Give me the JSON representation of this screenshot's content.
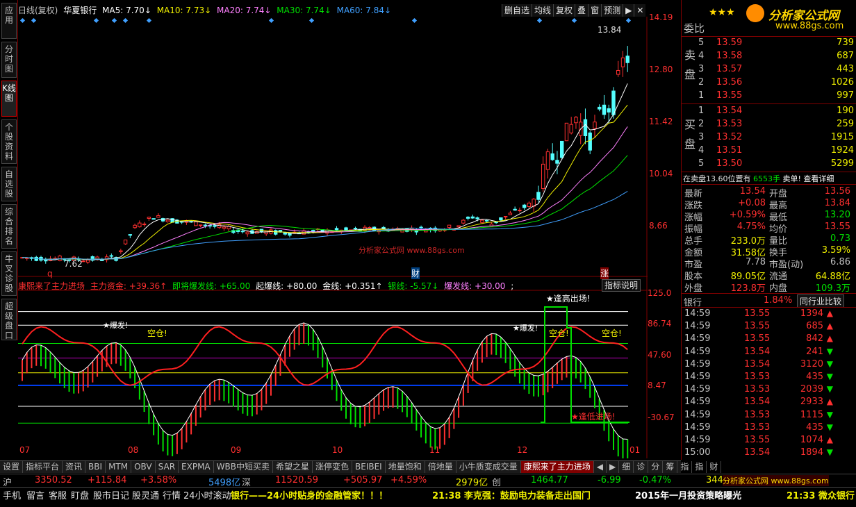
{
  "vertical_tabs": [
    "应用",
    "分时图",
    "K线图",
    "个股资料",
    "自选股",
    "综合排名",
    "牛叉诊股",
    "超级盘口"
  ],
  "header": {
    "period": "日线(复权)",
    "stock_name": "华夏银行",
    "ma5": "MA5: 7.70↓",
    "ma10": "MA10: 7.73↓",
    "ma20": "MA20: 7.74↓",
    "ma30": "MA30: 7.74↓",
    "ma60": "MA60: 7.84↓"
  },
  "toolbar": [
    "删自选",
    "均线",
    "复权",
    "叠",
    "窗",
    "预测",
    "▶",
    "✕"
  ],
  "price_axis": [
    "14.19",
    "12.80",
    "11.42",
    "10.04",
    "8.66"
  ],
  "chart_labels": {
    "high": "13.84",
    "low": "7.62",
    "q_marker": "q",
    "cai_marker": "财",
    "zhang_marker": "涨"
  },
  "watermark": "分析家公式网 www.88gs.com",
  "indicator": {
    "name": "康熙来了主力进场",
    "l1": "主力资金: +39.36↑",
    "l2": "即将爆发线: +65.00",
    "l3": "起爆线: +80.00",
    "l4": "金线: +0.351↑",
    "l5": "银线: -5.57↓",
    "l6": "爆发线: +30.00",
    "l7": ";",
    "btn": "指标说明",
    "axis": [
      "125.0",
      "86.74",
      "47.60",
      "8.47",
      "-30.67"
    ],
    "ann_fengao": "★逢高出场!",
    "ann_kongcang1": "空仓!",
    "ann_kongcang2": "空仓!",
    "ann_kongcang3": "空仓!",
    "ann_fengdi": "★逢低进场!",
    "ann_baofa1": "★爆发!",
    "ann_baofa2": "★爆发!"
  },
  "months": [
    "07",
    "08",
    "09",
    "10",
    "11",
    "12",
    "01"
  ],
  "bottom_tabs": [
    "设置",
    "指标平台",
    "资讯",
    "BBI",
    "MTM",
    "OBV",
    "SAR",
    "EXPMA",
    "WBB中短买卖",
    "希望之星",
    "涨停变色",
    "BEIBEI",
    "地量饱和",
    "倍地量",
    "小牛质变成交量",
    "康熙来了主力进场",
    "◀",
    "▶",
    "细",
    "诊",
    "分",
    "筹",
    "指",
    "指",
    "财"
  ],
  "orderbook": {
    "header": "委比",
    "sell_label": "卖盘",
    "buy_label": "买盘",
    "sells": [
      {
        "n": "5",
        "p": "13.59",
        "v": "739"
      },
      {
        "n": "4",
        "p": "13.58",
        "v": "687"
      },
      {
        "n": "3",
        "p": "13.57",
        "v": "443"
      },
      {
        "n": "2",
        "p": "13.56",
        "v": "1026"
      },
      {
        "n": "1",
        "p": "13.55",
        "v": "997"
      }
    ],
    "buys": [
      {
        "n": "1",
        "p": "13.54",
        "v": "190"
      },
      {
        "n": "2",
        "p": "13.53",
        "v": "259"
      },
      {
        "n": "3",
        "p": "13.52",
        "v": "1915"
      },
      {
        "n": "4",
        "p": "13.51",
        "v": "1924"
      },
      {
        "n": "5",
        "p": "13.50",
        "v": "5299"
      }
    ],
    "note_a": "在卖盘13.60位置有",
    "note_b": "6553手",
    "note_c": "卖单!",
    "note_d": "查看详细"
  },
  "quote": [
    {
      "k": "最新",
      "v": "13.54",
      "c": "#ff3030",
      "k2": "开盘",
      "v2": "13.56",
      "c2": "#ff3030"
    },
    {
      "k": "涨跌",
      "v": "+0.08",
      "c": "#ff3030",
      "k2": "最高",
      "v2": "13.84",
      "c2": "#ff3030"
    },
    {
      "k": "涨幅",
      "v": "+0.59%",
      "c": "#ff3030",
      "k2": "最低",
      "v2": "13.20",
      "c2": "#00e000"
    },
    {
      "k": "振幅",
      "v": "4.75%",
      "c": "#ff3030",
      "k2": "均价",
      "v2": "13.55",
      "c2": "#ff3030"
    },
    {
      "k": "总手",
      "v": "233.0万",
      "c": "#f0f000",
      "k2": "量比",
      "v2": "0.73",
      "c2": "#00e000"
    },
    {
      "k": "金额",
      "v": "31.58亿",
      "c": "#f0f000",
      "k2": "换手",
      "v2": "3.59%",
      "c2": "#f0f000"
    },
    {
      "k": "市盈",
      "v": "7.78",
      "c": "#c0c0c0",
      "k2": "市盈(动)",
      "v2": "6.86",
      "c2": "#c0c0c0"
    },
    {
      "k": "股本",
      "v": "89.05亿",
      "c": "#f0f000",
      "k2": "流通",
      "v2": "64.88亿",
      "c2": "#f0f000"
    },
    {
      "k": "外盘",
      "v": "123.8万",
      "c": "#ff3030",
      "k2": "内盘",
      "v2": "109.3万",
      "c2": "#00e000"
    }
  ],
  "industry": {
    "name": "银行",
    "pct": "1.84%",
    "btn": "同行业比较"
  },
  "ticks": [
    {
      "t": "14:59",
      "p": "13.55",
      "v": "1394",
      "a": "▲"
    },
    {
      "t": "14:59",
      "p": "13.55",
      "v": "685",
      "a": "▲"
    },
    {
      "t": "14:59",
      "p": "13.55",
      "v": "842",
      "a": "▲"
    },
    {
      "t": "14:59",
      "p": "13.54",
      "v": "241",
      "a": "▼"
    },
    {
      "t": "14:59",
      "p": "13.54",
      "v": "3120",
      "a": "▼"
    },
    {
      "t": "14:59",
      "p": "13.53",
      "v": "435",
      "a": "▼"
    },
    {
      "t": "14:59",
      "p": "13.53",
      "v": "2039",
      "a": "▼"
    },
    {
      "t": "14:59",
      "p": "13.54",
      "v": "2933",
      "a": "▲"
    },
    {
      "t": "14:59",
      "p": "13.53",
      "v": "1115",
      "a": "▼"
    },
    {
      "t": "14:59",
      "p": "13.53",
      "v": "435",
      "a": "▼"
    },
    {
      "t": "14:59",
      "p": "13.55",
      "v": "1074",
      "a": "▲"
    },
    {
      "t": "15:00",
      "p": "13.54",
      "v": "1894",
      "a": "▼"
    }
  ],
  "index_bar": {
    "sh": "沪",
    "sh_v": "3350.52",
    "sh_c": "+115.84",
    "sh_p": "+3.58%",
    "sh_amt": "5498亿",
    "sz": "深",
    "sz_v": "11520.59",
    "sz_c": "+505.97",
    "sz_p": "+4.59%",
    "sz_amt": "2979亿",
    "cy": "创",
    "cy_v": "1464.77",
    "cy_c": "-6.99",
    "cy_p": "-0.47%",
    "cy_amt": "344"
  },
  "news_bar": {
    "links": [
      "手机",
      "留言",
      "客服",
      "盯盘",
      "股市日记",
      "股灵通",
      "行情",
      "24小时滚动"
    ],
    "n1": "银行——24小时贴身的金融管家！！！",
    "n2": "21:38 李克强：鼓励电力装备走出国门",
    "n3": "2015年一月投资策略曝光",
    "n4": "21:33 微众银行"
  },
  "logo": {
    "text": "分析家公式网",
    "url": "www.88gs.com",
    "stars": "★★★"
  },
  "logo2": "分析家公式网 www.88gs.com",
  "colors": {
    "up": "#ff3030",
    "down": "#00e0ff",
    "ma5": "#ffffff",
    "ma10": "#f0f000",
    "ma20": "#ff80ff",
    "ma30": "#00e000",
    "ma60": "#40a0ff"
  }
}
